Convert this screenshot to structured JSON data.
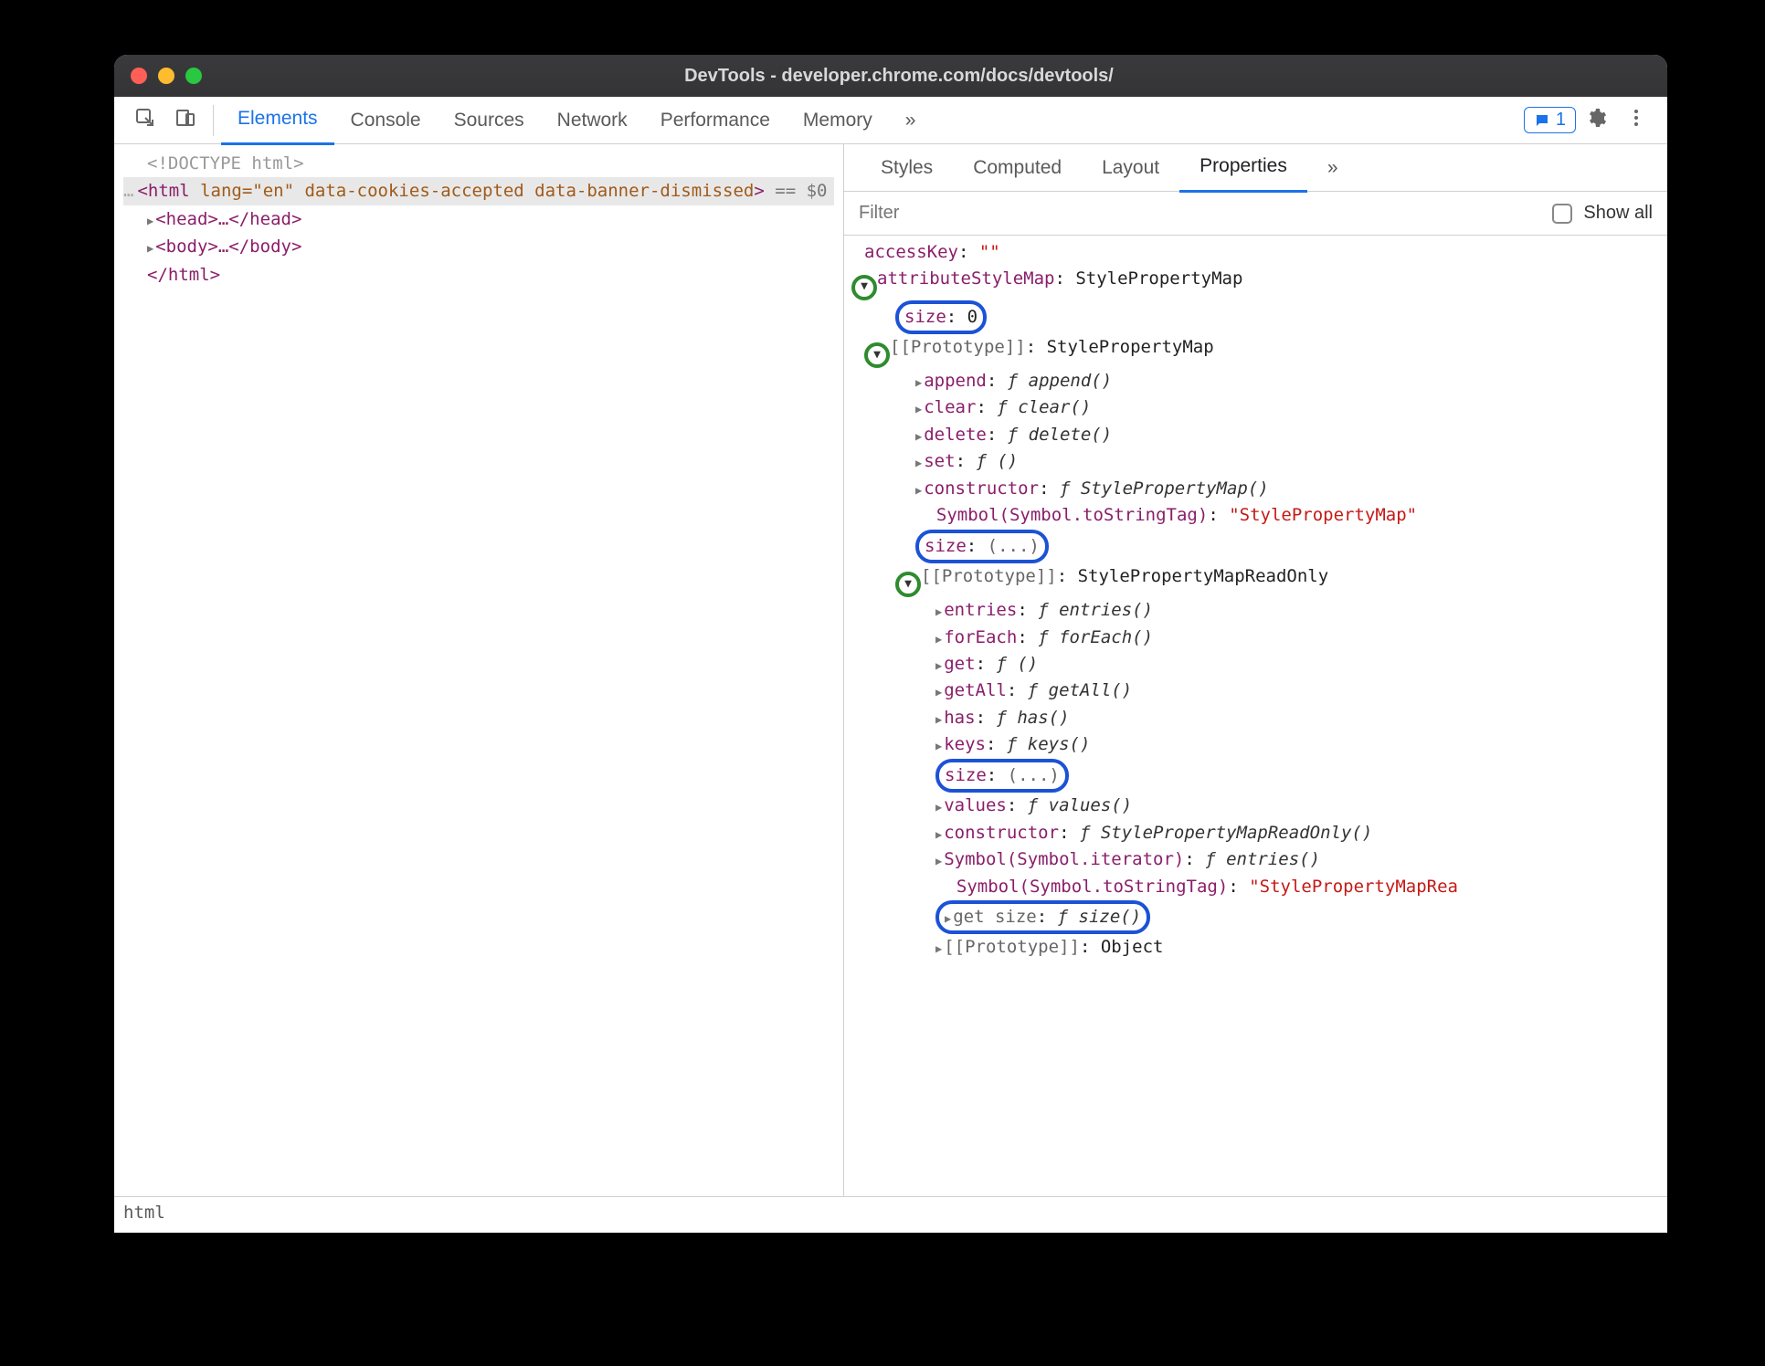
{
  "window": {
    "title": "DevTools - developer.chrome.com/docs/devtools/"
  },
  "toolbar": {
    "tabs": [
      "Elements",
      "Console",
      "Sources",
      "Network",
      "Performance",
      "Memory"
    ],
    "more": "»",
    "issues_count": "1"
  },
  "dom": {
    "doctype": "<!DOCTYPE html>",
    "html_open": "<html ",
    "lang_attr": "lang=\"en\"",
    "rest_attrs": " data-cookies-accepted data-banner-dismissed",
    "html_close_bracket": ">",
    "eq_dollar": " == $0",
    "head": "<head>…</head>",
    "body": "<body>…</body>",
    "html_close": "</html>",
    "crumb": "html"
  },
  "sidebar": {
    "tabs": [
      "Styles",
      "Computed",
      "Layout",
      "Properties"
    ],
    "more": "»",
    "filter_placeholder": "Filter",
    "show_all": "Show all"
  },
  "props": {
    "accessKey": {
      "k": "accessKey",
      "v": "\"\""
    },
    "attrMap": {
      "k": "attributeStyleMap",
      "v": "StylePropertyMap"
    },
    "size0": {
      "k": "size",
      "v": "0"
    },
    "proto1": {
      "k": "[[Prototype]]",
      "v": "StylePropertyMap"
    },
    "append": {
      "k": "append",
      "v": "ƒ append()"
    },
    "clear": {
      "k": "clear",
      "v": "ƒ clear()"
    },
    "delete": {
      "k": "delete",
      "v": "ƒ delete()"
    },
    "set": {
      "k": "set",
      "v": "ƒ ()"
    },
    "ctor1": {
      "k": "constructor",
      "v": "ƒ StylePropertyMap()"
    },
    "sym1": {
      "k": "Symbol(Symbol.toStringTag)",
      "v": "\"StylePropertyMap\""
    },
    "sizeE1": {
      "k": "size",
      "v": "(...)"
    },
    "proto2": {
      "k": "[[Prototype]]",
      "v": "StylePropertyMapReadOnly"
    },
    "entries": {
      "k": "entries",
      "v": "ƒ entries()"
    },
    "forEach": {
      "k": "forEach",
      "v": "ƒ forEach()"
    },
    "get": {
      "k": "get",
      "v": "ƒ ()"
    },
    "getAll": {
      "k": "getAll",
      "v": "ƒ getAll()"
    },
    "has": {
      "k": "has",
      "v": "ƒ has()"
    },
    "keys": {
      "k": "keys",
      "v": "ƒ keys()"
    },
    "sizeE2": {
      "k": "size",
      "v": "(...)"
    },
    "values": {
      "k": "values",
      "v": "ƒ values()"
    },
    "ctor2": {
      "k": "constructor",
      "v": "ƒ StylePropertyMapReadOnly()"
    },
    "symIter": {
      "k": "Symbol(Symbol.iterator)",
      "v": "ƒ entries()"
    },
    "sym2": {
      "k": "Symbol(Symbol.toStringTag)",
      "v": "\"StylePropertyMapRea"
    },
    "getSize": {
      "k": "get size",
      "v": "ƒ size()"
    },
    "proto3": {
      "k": "[[Prototype]]",
      "v": "Object"
    }
  }
}
